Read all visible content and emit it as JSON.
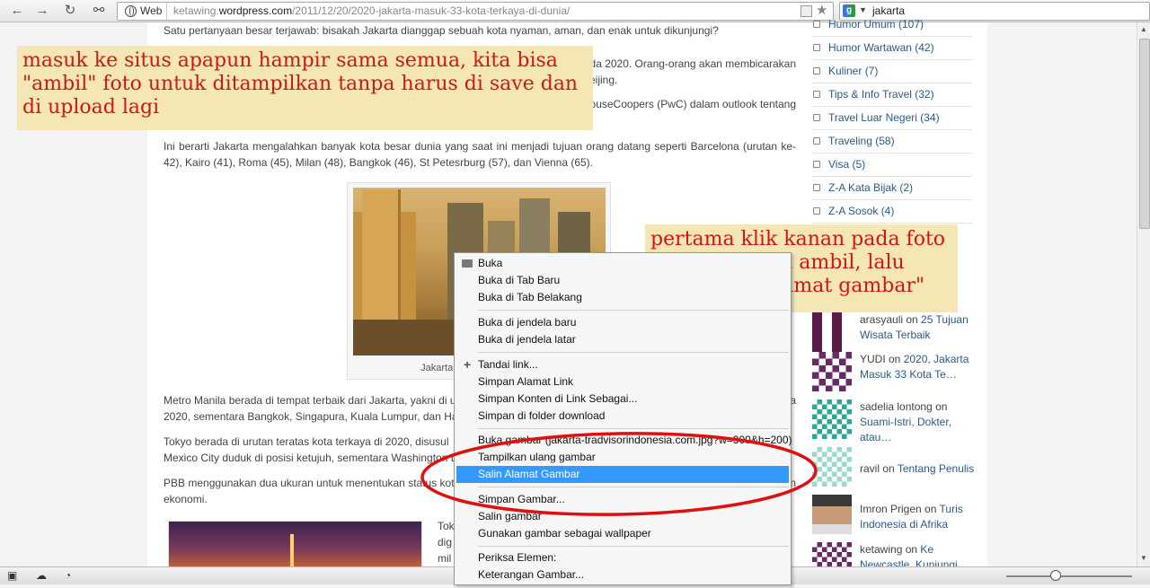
{
  "browser": {
    "web_label": "Web",
    "url_domain": "ketawing.",
    "url_bold": "wordpress.com",
    "url_path": "/2011/12/20/2020-jakarta-masuk-33-kota-terkaya-di-dunia/",
    "search_text": "jakarta"
  },
  "article": {
    "p1": "Satu pertanyaan besar terjawab: bisakah Jakarta dianggap sebuah kota nyaman, aman, dan enak untuk dikunjungi?",
    "p2_end_a": "da 2020. Orang-orang akan membicarakan",
    "p2_end_b": "eijing.",
    "p3_end": "houseCoopers (PwC) dalam outlook tentang",
    "p4": "Ini berarti Jakarta mengalahkan banyak kota besar dunia yang saat ini menjadi tujuan orang datang seperti Barcelona (urutan ke-42), Kairo (41), Roma (45), Milan (48), Bangkok (46), St Petesrburg (57), dan Vienna (65).",
    "caption": "Jakarta (courtes",
    "p5a": "Metro Manila berada di tempat terbaik dari Jakarta, yakni di urut",
    "p5a_end": "a",
    "p5b": "2020, sementara Bangkok, Singapura, Kuala Lumpur, dan Han",
    "p6a": "Tokyo berada di urutan teratas kota terkaya di 2020, disusul",
    "p6b": "Mexico City duduk di posisi ketujuh, sementara Washington D",
    "p7a": "PBB menggunakan dua ukuran untuk menentukan status kot",
    "p7a_end": "n",
    "p7b": "ekonomi.",
    "p8a": "Tok",
    "p8b": "dig",
    "p8c": "mil"
  },
  "sidebar": {
    "categories": [
      {
        "label": "Humor Umum (107)"
      },
      {
        "label": "Humor Wartawan (42)"
      },
      {
        "label": "Kuliner (7)"
      },
      {
        "label": "Tips & Info Travel (32)"
      },
      {
        "label": "Travel Luar Negeri (34)"
      },
      {
        "label": "Traveling (58)"
      },
      {
        "label": "Visa (5)"
      },
      {
        "label": "Z-A Kata Bijak (2)"
      },
      {
        "label": "Z-A Sosok (4)"
      }
    ],
    "comments": [
      {
        "author": "arasyauli",
        "on": " on ",
        "post": "25 Tujuan Wisata Terbaik"
      },
      {
        "author": "YUDI",
        "on": " on ",
        "post": "2020, Jakarta Masuk 33 Kota Te…"
      },
      {
        "author": "sadelia lontong",
        "on": " on ",
        "post": "Suami-Istri, Dokter, atau…"
      },
      {
        "author": "ravil",
        "on": " on ",
        "post": "Tentang Penulis"
      },
      {
        "author": "Imron Prigen",
        "on": " on ",
        "post": "Turis Indonesia di Afrika"
      },
      {
        "author": "ketawing",
        "on": " on ",
        "post": "Ke Newcastle, Kunjungi 9…"
      }
    ]
  },
  "context_menu": {
    "items": [
      "Buka",
      "Buka di Tab Baru",
      "Buka di Tab Belakang",
      "Buka di jendela baru",
      "Buka di jendela latar",
      "Tandai link...",
      "Simpan Alamat Link",
      "Simpan Konten di Link Sebagai...",
      "Simpan di folder download",
      "Buka gambar (jakarta-tradvisorindonesia.com.jpg?w=300&h=200)",
      "Tampilkan ulang gambar",
      "Salin Alamat Gambar",
      "Simpan Gambar...",
      "Salin gambar",
      "Gunakan gambar sebagai wallpaper",
      "Periksa Elemen:",
      "Keterangan Gambar..."
    ],
    "highlighted": "Salin Alamat Gambar"
  },
  "annotations": {
    "note1": "masuk ke situs apapun hampir sama semua, kita bisa \"ambil\" foto untuk ditampilkan tanpa harus di save dan di upload lagi",
    "note2": "pertama klik kanan pada foto yang mau kita ambil, lalu pilih \"salin alamat gambar\""
  },
  "colors": {
    "note_bg": "#f5e6b5",
    "note_text": "#d0161a",
    "highlight": "#3399ff",
    "ellipse": "#e01010",
    "link": "#2a5a8a"
  },
  "icons": [
    "back-icon",
    "forward-icon",
    "reload-icon",
    "key-icon",
    "globe-icon",
    "rss-icon",
    "star-icon",
    "google-icon",
    "folder-icon",
    "plus-icon",
    "cloud-icon",
    "gauge-icon"
  ]
}
